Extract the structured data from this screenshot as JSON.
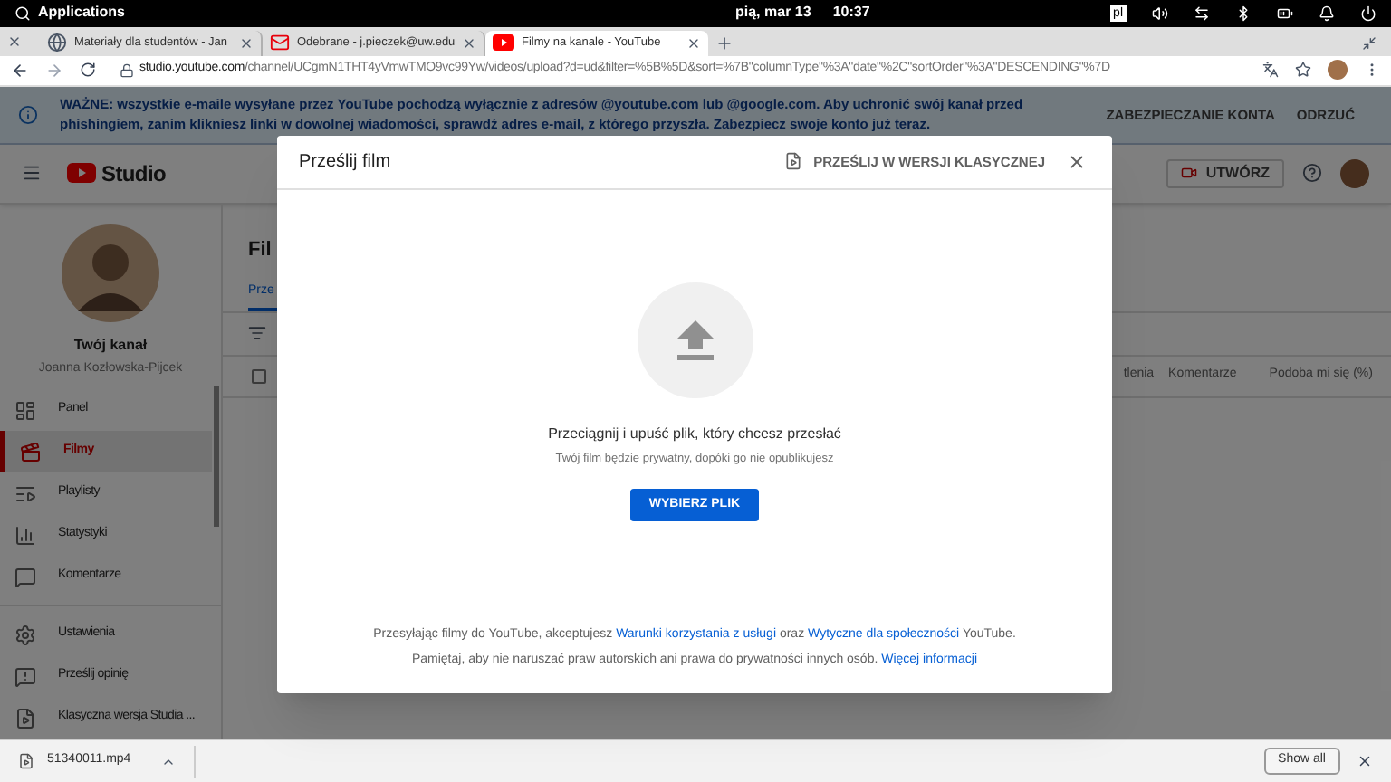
{
  "system_bar": {
    "menu": "Applications",
    "date": "pią, mar 13",
    "time": "10:37",
    "keyboard_layout": "pl"
  },
  "browser": {
    "tabs": [
      {
        "title": "Materiały dla studentów - Jan",
        "selected": false
      },
      {
        "title": "Odebrane - j.pieczek@uw.edu",
        "selected": false
      },
      {
        "title": "Filmy na kanale - YouTube",
        "selected": true
      }
    ],
    "url_host": "studio.youtube.com",
    "url_path": "/channel/UCgmN1THT4yVmwTMO9vc99Yw/videos/upload?d=ud&filter=%5B%5D&sort=%7B\"columnType\"%3A\"date\"%2C\"sortOrder\"%3A\"DESCENDING\"%7D"
  },
  "banner": {
    "text": "WAŻNE: wszystkie e-maile wysyłane przez YouTube pochodzą wyłącznie z adresów @youtube.com lub @google.com. Aby uchronić swój kanał przed phishingiem, zanim klikniesz linki w dowolnej wiadomości, sprawdź adres e-mail, z którego przyszła. Zabezpiecz swoje konto już teraz.",
    "actions": [
      "ZABEZPIECZANIE KONTA",
      "ODRZUĆ"
    ]
  },
  "header": {
    "logo": "Studio",
    "create_button": "UTWÓRZ"
  },
  "sidebar": {
    "channel_title": "Twój kanał",
    "channel_owner": "Joanna Kozłowska-Pijcek",
    "items": [
      {
        "label": "Panel",
        "selected": false
      },
      {
        "label": "Filmy",
        "selected": true
      },
      {
        "label": "Playlisty",
        "selected": false
      },
      {
        "label": "Statystyki",
        "selected": false
      },
      {
        "label": "Komentarze",
        "selected": false
      }
    ],
    "footer_items": [
      {
        "label": "Ustawienia",
        "selected": false
      },
      {
        "label": "Prześlij opinię",
        "selected": false
      },
      {
        "label": "Klasyczna wersja Studia ...",
        "selected": false
      }
    ]
  },
  "page": {
    "title": "Fil",
    "tab": "Prze",
    "select_all_checked": false,
    "columns": [
      "tlenia",
      "Komentarze",
      "Podoba mi się (%)"
    ]
  },
  "dialog": {
    "title": "Prześlij film",
    "classic_button": "PRZEŚLIJ W WERSJI KLASYCZNEJ",
    "drop_text": "Przeciągnij i upuść plik, który chcesz przesłać",
    "privacy_note": "Twój film będzie prywatny, dopóki go nie opublikujesz",
    "select_button": "WYBIERZ PLIK",
    "terms": [
      {
        "kind": "text",
        "text": "Przesyłając filmy do YouTube, akceptujesz "
      },
      {
        "kind": "link",
        "text": "Warunki korzystania z usługi"
      },
      {
        "kind": "text",
        "text": " oraz "
      },
      {
        "kind": "link",
        "text": "Wytyczne dla społeczności"
      },
      {
        "kind": "text",
        "text": " YouTube."
      }
    ],
    "copyright": [
      {
        "kind": "text",
        "text": "Pamiętaj, aby nie naruszać praw autorskich ani prawa do prywatności innych osób. "
      },
      {
        "kind": "link",
        "text": "Więcej informacji"
      }
    ]
  },
  "downloads": {
    "file": "51340011.mp4",
    "show_all": "Show all"
  }
}
